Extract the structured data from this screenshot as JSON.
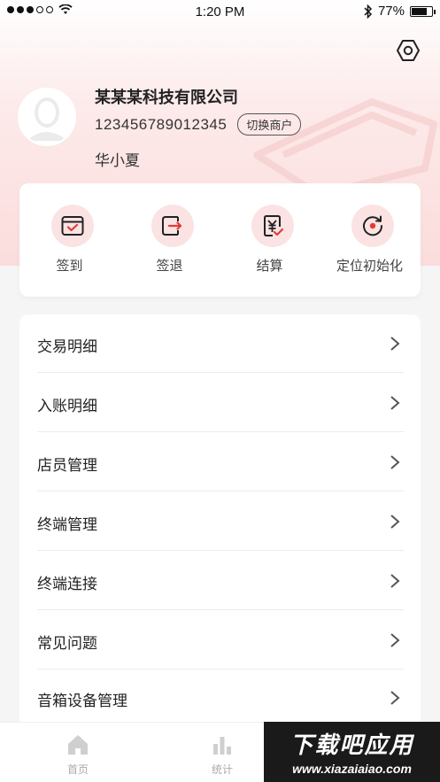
{
  "status_bar": {
    "time": "1:20 PM",
    "battery": "77%",
    "battery_level": 0.77
  },
  "header": {
    "company": "某某某科技有限公司",
    "account_no": "123456789012345",
    "switch_label": "切换商户",
    "username": "华小夏"
  },
  "quick_actions": [
    {
      "label": "签到",
      "icon": "calendar-check-icon"
    },
    {
      "label": "签退",
      "icon": "logout-icon"
    },
    {
      "label": "结算",
      "icon": "yuan-check-icon"
    },
    {
      "label": "定位初始化",
      "icon": "refresh-target-icon"
    }
  ],
  "menu": [
    {
      "label": "交易明细"
    },
    {
      "label": "入账明细"
    },
    {
      "label": "店员管理"
    },
    {
      "label": "终端管理"
    },
    {
      "label": "终端连接"
    },
    {
      "label": "常见问题"
    },
    {
      "label": "音箱设备管理"
    }
  ],
  "tabbar": [
    {
      "label": "首页",
      "icon": "home-icon"
    },
    {
      "label": "统计",
      "icon": "bar-chart-icon"
    }
  ],
  "watermark": {
    "title": "下载吧应用",
    "url": "www.xiazaiaiao.com"
  },
  "colors": {
    "accent": "#e23b3b",
    "icon_bg": "#fbe3e3",
    "header_bg": "#fbdcdc"
  }
}
